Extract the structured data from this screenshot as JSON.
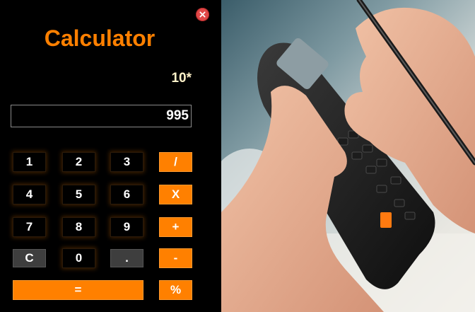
{
  "app": {
    "title": "Calculator"
  },
  "display": {
    "expression": "10*",
    "value": "995"
  },
  "keys": {
    "k1": "1",
    "k2": "2",
    "k3": "3",
    "divide": "/",
    "k4": "4",
    "k5": "5",
    "k6": "6",
    "multiply": "X",
    "k7": "7",
    "k8": "8",
    "k9": "9",
    "add": "+",
    "clear": "C",
    "k0": "0",
    "decimal": ".",
    "subtract": "-",
    "equals": "=",
    "percent": "%"
  },
  "colors": {
    "accent": "#ff8000",
    "close": "#e04848",
    "background": "#000000"
  },
  "icons": {
    "close": "close-icon"
  }
}
